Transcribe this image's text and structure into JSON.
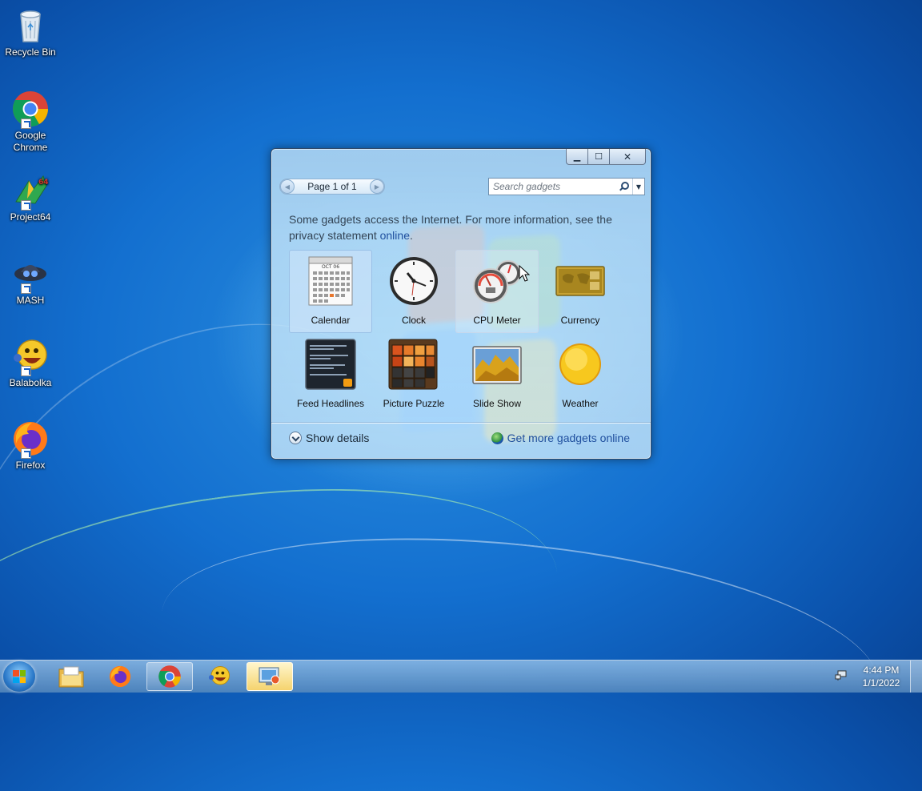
{
  "desktop": {
    "icons": [
      {
        "label": "Recycle Bin",
        "icon": "recycle-bin-icon"
      },
      {
        "label": "Google Chrome",
        "icon": "chrome-icon"
      },
      {
        "label": "Project64",
        "icon": "project64-icon"
      },
      {
        "label": "MASH",
        "icon": "mash-icon"
      },
      {
        "label": "Balabolka",
        "icon": "balabolka-icon"
      },
      {
        "label": "Firefox",
        "icon": "firefox-icon"
      }
    ]
  },
  "gadgets_window": {
    "caption_buttons": {
      "minimize": "▁",
      "maximize": "☐",
      "close": "✕"
    },
    "pager": {
      "text": "Page 1 of 1",
      "prev": "◀",
      "next": "▶"
    },
    "search": {
      "placeholder": "Search gadgets"
    },
    "notice": {
      "text": "Some gadgets access the Internet.  For more information, see the privacy statement ",
      "link": "online",
      "suffix": "."
    },
    "gadgets": [
      {
        "label": "Calendar",
        "icon": "calendar-gadget-icon",
        "state": "selected"
      },
      {
        "label": "Clock",
        "icon": "clock-gadget-icon",
        "state": "normal"
      },
      {
        "label": "CPU Meter",
        "icon": "cpu-meter-gadget-icon",
        "state": "hover"
      },
      {
        "label": "Currency",
        "icon": "currency-gadget-icon",
        "state": "normal"
      },
      {
        "label": "Feed Headlines",
        "icon": "feed-headlines-gadget-icon",
        "state": "normal"
      },
      {
        "label": "Picture Puzzle",
        "icon": "picture-puzzle-gadget-icon",
        "state": "normal"
      },
      {
        "label": "Slide Show",
        "icon": "slide-show-gadget-icon",
        "state": "normal"
      },
      {
        "label": "Weather",
        "icon": "weather-gadget-icon",
        "state": "normal"
      }
    ],
    "calendar_month": "OCT 06",
    "footer": {
      "show_details": "Show details",
      "more_online": "Get more gadgets online"
    }
  },
  "taskbar": {
    "buttons": [
      {
        "name": "file-explorer",
        "icon": "folder-icon"
      },
      {
        "name": "firefox",
        "icon": "firefox-icon"
      },
      {
        "name": "chrome",
        "icon": "chrome-icon",
        "state": "open"
      },
      {
        "name": "balabolka",
        "icon": "balabolka-icon"
      },
      {
        "name": "gadgets",
        "icon": "gadgets-icon",
        "state": "active"
      }
    ],
    "clock": {
      "time": "4:44 PM",
      "date": "1/1/2022"
    }
  },
  "colors": {
    "desktop_blue": "#136fcf",
    "link_blue": "#1f4f9e",
    "active_taskbar": "#f5d36e"
  }
}
